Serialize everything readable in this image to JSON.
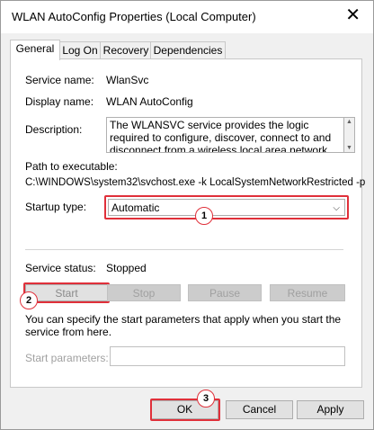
{
  "window": {
    "title": "WLAN AutoConfig Properties (Local Computer)",
    "close_glyph": "✕"
  },
  "tabs": [
    {
      "label": "General"
    },
    {
      "label": "Log On"
    },
    {
      "label": "Recovery"
    },
    {
      "label": "Dependencies"
    }
  ],
  "fields": {
    "service_name_label": "Service name:",
    "service_name": "WlanSvc",
    "display_name_label": "Display name:",
    "display_name": "WLAN AutoConfig",
    "description_label": "Description:",
    "description": "The WLANSVC service provides the logic required to configure, discover, connect to and disconnect from a wireless local area network (WLAN) as",
    "path_label": "Path to executable:",
    "path": "C:\\WINDOWS\\system32\\svchost.exe -k LocalSystemNetworkRestricted -p",
    "startup_type_label": "Startup type:",
    "startup_type": "Automatic",
    "service_status_label": "Service status:",
    "service_status": "Stopped"
  },
  "buttons": {
    "start": "Start",
    "stop": "Stop",
    "pause": "Pause",
    "resume": "Resume"
  },
  "help_text": "You can specify the start parameters that apply when you start the service from here.",
  "start_params_label": "Start parameters:",
  "start_params_value": "",
  "bottom": {
    "ok": "OK",
    "cancel": "Cancel",
    "apply": "Apply"
  },
  "annotations": {
    "one": "1",
    "two": "2",
    "three": "3"
  },
  "colors": {
    "highlight": "#e0303a",
    "panel": "#ffffff",
    "chrome": "#f0f0f0"
  }
}
